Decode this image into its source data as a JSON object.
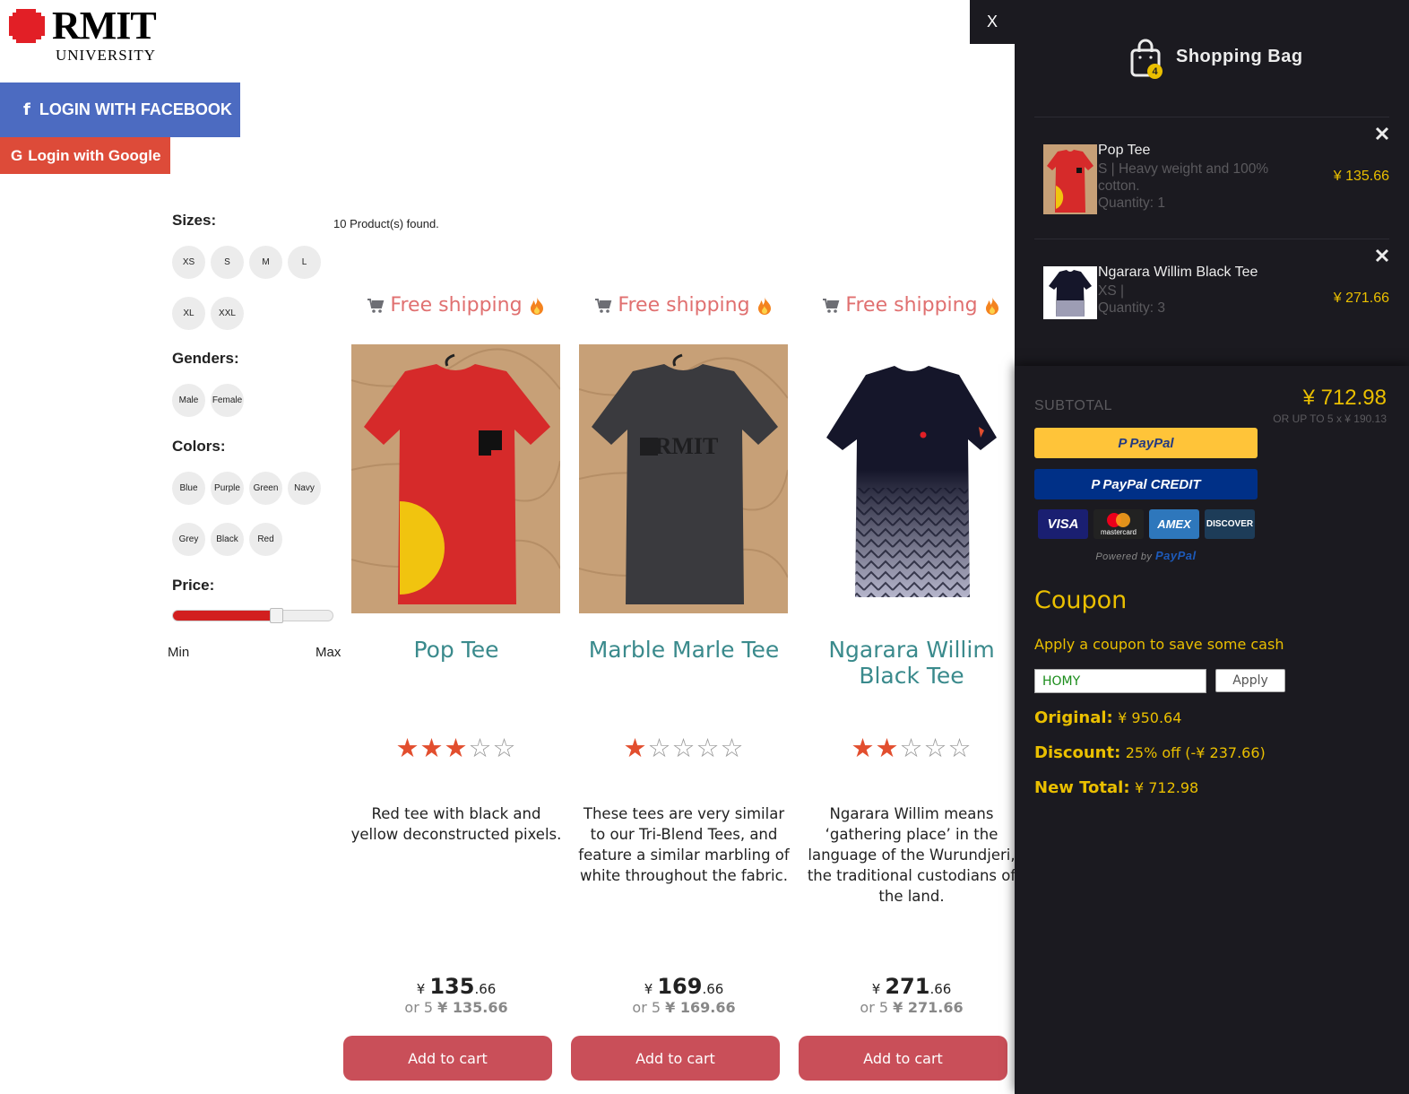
{
  "brand": {
    "name": "RMIT",
    "sub": "UNIVERSITY"
  },
  "auth": {
    "facebook": "LOGIN WITH FACEBOOK",
    "google": "Login with Google"
  },
  "filters": {
    "sizes_title": "Sizes:",
    "sizes": [
      "XS",
      "S",
      "M",
      "L",
      "XL",
      "XXL"
    ],
    "genders_title": "Genders:",
    "genders": [
      "Male",
      "Female"
    ],
    "colors_title": "Colors:",
    "colors": [
      "Blue",
      "Purple",
      "Green",
      "Navy",
      "Grey",
      "Black",
      "Red"
    ],
    "price_title": "Price:",
    "price_level": 0.65,
    "min": "Min",
    "max": "Max"
  },
  "results": {
    "found": "10 Product(s) found."
  },
  "products": [
    {
      "free_shipping": "Free shipping",
      "name": "Pop Tee",
      "rating": 3,
      "desc": "Red tee with black and yellow deconstructed pixels.",
      "currency": "¥",
      "price_int": "135",
      "price_dec": ".66",
      "installments": "or 5",
      "inst_price": "¥ 135.66",
      "add": "Add to cart",
      "color": "#d62a2a"
    },
    {
      "free_shipping": "Free shipping",
      "name": "Marble Marle Tee",
      "rating": 1,
      "desc": "These tees are very similar to our Tri-Blend Tees, and feature a similar marbling of white throughout the fabric.",
      "currency": "¥",
      "price_int": "169",
      "price_dec": ".66",
      "installments": "or 5",
      "inst_price": "¥ 169.66",
      "add": "Add to cart",
      "color": "#3a3a3e"
    },
    {
      "free_shipping": "Free shipping",
      "name": "Ngarara Willim Black Tee",
      "rating": 2,
      "desc": "Ngarara Willim means ‘gathering place’ in the language of the Wurundjeri, the traditional custodians of the land.",
      "currency": "¥",
      "price_int": "271",
      "price_dec": ".66",
      "installments": "or 5",
      "inst_price": "¥ 271.66",
      "add": "Add to cart",
      "color": "#15162a"
    }
  ],
  "cart": {
    "close": "X",
    "title": "Shopping Bag",
    "count": "4",
    "items": [
      {
        "title": "Pop Tee",
        "desc": "S | Heavy weight and 100% cotton.",
        "qty": "Quantity: 1",
        "price": "¥ 135.66"
      },
      {
        "title": "Ngarara Willim Black Tee",
        "desc": "XS |",
        "qty": "Quantity: 3",
        "price": "¥ 271.66"
      }
    ],
    "subtotal_label": "SUBTOTAL",
    "subtotal": "¥ 712.98",
    "subtotal_inst": "OR UP TO 5 x ¥ 190.13",
    "paypal": "PayPal",
    "paypal_credit": "PayPal CREDIT",
    "cards": [
      "VISA",
      "mastercard",
      "AMEX",
      "DISCOVER"
    ],
    "powered_by": "Powered by",
    "powered_brand": "PayPal",
    "coupon_title": "Coupon",
    "coupon_sub": "Apply a coupon to save some cash",
    "coupon_value": "HOMY",
    "apply": "Apply",
    "original_label": "Original:",
    "original": "¥ 950.64",
    "discount_label": "Discount:",
    "discount": "25% off (-¥ 237.66)",
    "newtotal_label": "New Total:",
    "newtotal": "¥ 712.98"
  },
  "colors": {
    "accent_yellow": "#eabf00",
    "panel_bg": "#1b1a20",
    "button_red": "#c94f59",
    "facebook": "#4c6bc1",
    "google": "#dd4b39",
    "teal": "#3a8a8c"
  }
}
